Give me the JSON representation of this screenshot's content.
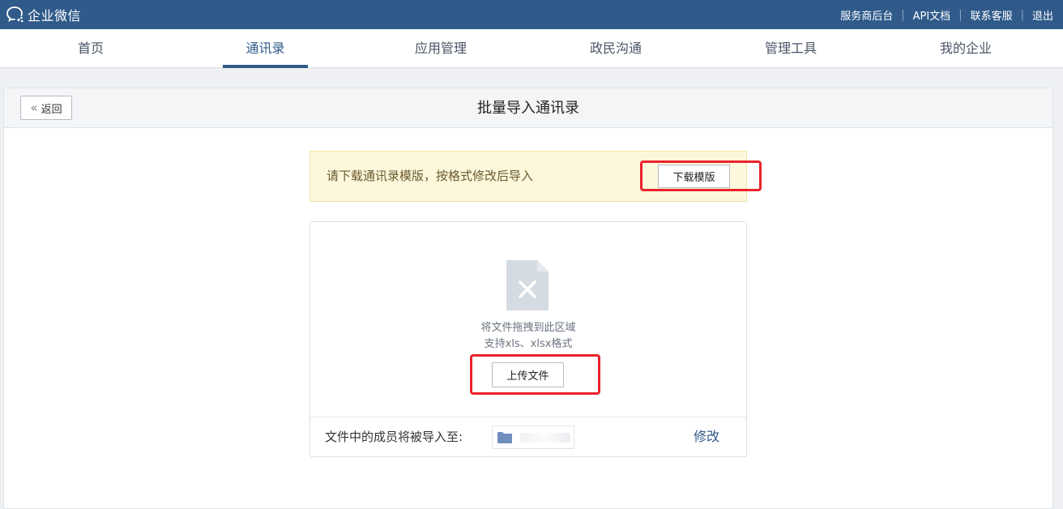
{
  "app": {
    "title": "企业微信"
  },
  "toplinks": [
    {
      "label": "服务商后台"
    },
    {
      "label": "API文档"
    },
    {
      "label": "联系客服"
    },
    {
      "label": "退出"
    }
  ],
  "nav": {
    "items": [
      {
        "label": "首页"
      },
      {
        "label": "通讯录"
      },
      {
        "label": "应用管理"
      },
      {
        "label": "政民沟通"
      },
      {
        "label": "管理工具"
      },
      {
        "label": "我的企业"
      }
    ],
    "active": "通讯录"
  },
  "page": {
    "back_label": "返回",
    "title": "批量导入通讯录"
  },
  "notice": {
    "text": "请下载通讯录模版，按格式修改后导入",
    "button_label": "下载模版"
  },
  "upload": {
    "drop_hint": "将文件拖拽到此区域",
    "format_hint": "支持xls、xlsx格式",
    "button_label": "上传文件"
  },
  "import_target": {
    "label": "文件中的成员将被导入至:",
    "modify_label": "修改"
  },
  "colors": {
    "brand": "#2f5a8a",
    "highlight": "#e8242b",
    "notice_bg": "#fdf7dc"
  },
  "icons": {
    "logo": "wechat-work-logo-icon",
    "back": "double-chevron-left-icon",
    "file": "invalid-file-icon",
    "folder": "folder-icon"
  }
}
